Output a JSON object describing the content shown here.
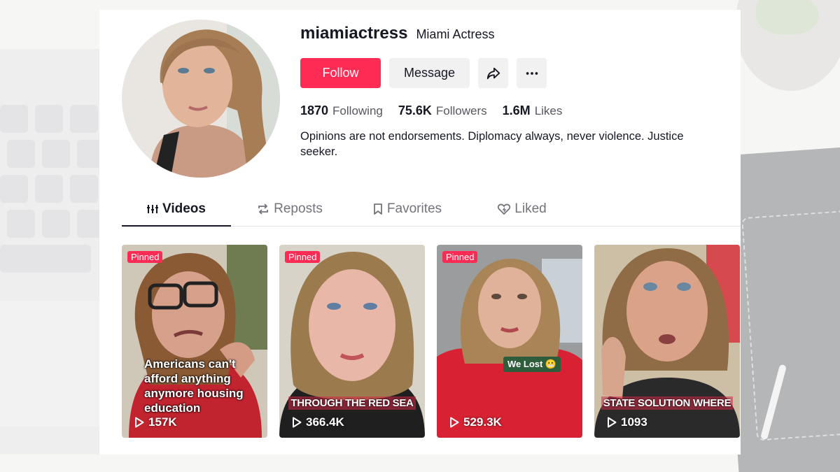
{
  "profile": {
    "username": "miamiactress",
    "nickname": "Miami Actress",
    "bio": "Opinions are not endorsements. Diplomacy always, never violence. Justice seeker."
  },
  "actions": {
    "follow_label": "Follow",
    "message_label": "Message",
    "share_icon": "share-arrow-icon",
    "more_icon": "more-dots-icon"
  },
  "stats": {
    "following": {
      "value": "1870",
      "label": "Following"
    },
    "followers": {
      "value": "75.6K",
      "label": "Followers"
    },
    "likes": {
      "value": "1.6M",
      "label": "Likes"
    }
  },
  "tabs": [
    {
      "label": "Videos",
      "icon": "grid-bars-icon",
      "active": true
    },
    {
      "label": "Reposts",
      "icon": "repost-icon",
      "active": false
    },
    {
      "label": "Favorites",
      "icon": "bookmark-icon",
      "active": false
    },
    {
      "label": "Liked",
      "icon": "heart-outline-icon",
      "active": false
    }
  ],
  "videos": [
    {
      "pinned_label": "Pinned",
      "caption": "Americans can't afford anything anymore housing education",
      "views": "157K"
    },
    {
      "pinned_label": "Pinned",
      "caption": "THROUGH THE RED SEA",
      "views": "366.4K"
    },
    {
      "pinned_label": "Pinned",
      "tag": "We Lost 😬",
      "views": "529.3K"
    },
    {
      "caption": "STATE SOLUTION WHERE",
      "views": "1093"
    }
  ],
  "colors": {
    "accent": "#fe2c55",
    "text": "#161823",
    "muted": "#73747b"
  }
}
